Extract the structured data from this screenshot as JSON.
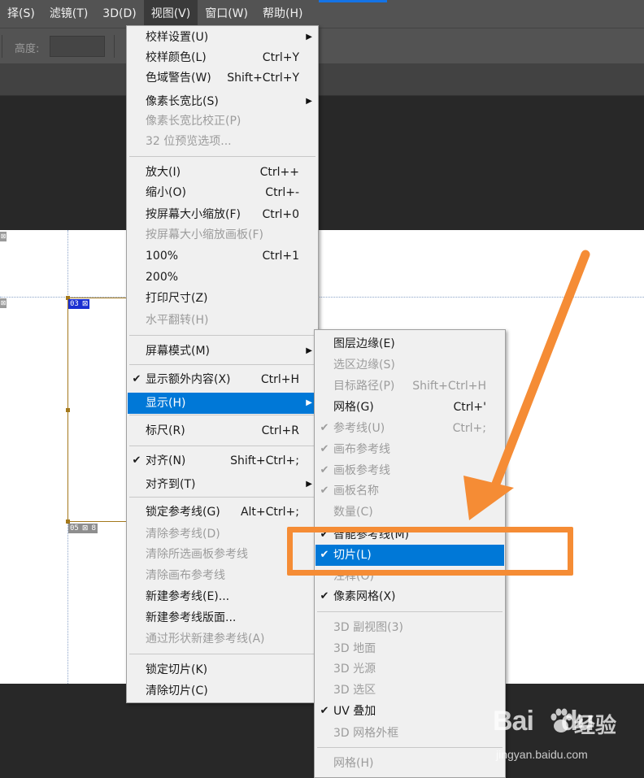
{
  "menubar": {
    "items": [
      "择(S)",
      "滤镜(T)",
      "3D(D)",
      "视图(V)",
      "窗口(W)",
      "帮助(H)"
    ]
  },
  "options_bar": {
    "height_label": "高度:"
  },
  "canvas": {
    "slice_top_label": "03",
    "slice_bottom_label": "05"
  },
  "view_menu": {
    "items": [
      {
        "label": "校样设置(U)",
        "shortcut": "",
        "submenu": true,
        "enabled": true,
        "checked": false
      },
      {
        "label": "校样颜色(L)",
        "shortcut": "Ctrl+Y",
        "enabled": true,
        "checked": false
      },
      {
        "label": "色域警告(W)",
        "shortcut": "Shift+Ctrl+Y",
        "enabled": true,
        "checked": false
      },
      {
        "label": "像素长宽比(S)",
        "shortcut": "",
        "submenu": true,
        "enabled": true,
        "checked": false
      },
      {
        "label": "像素长宽比校正(P)",
        "shortcut": "",
        "enabled": false,
        "checked": false
      },
      {
        "label": "32 位预览选项...",
        "shortcut": "",
        "enabled": false,
        "checked": false
      },
      {
        "label": "放大(I)",
        "shortcut": "Ctrl++",
        "enabled": true,
        "checked": false
      },
      {
        "label": "缩小(O)",
        "shortcut": "Ctrl+-",
        "enabled": true,
        "checked": false
      },
      {
        "label": "按屏幕大小缩放(F)",
        "shortcut": "Ctrl+0",
        "enabled": true,
        "checked": false
      },
      {
        "label": "按屏幕大小缩放画板(F)",
        "shortcut": "",
        "enabled": false,
        "checked": false
      },
      {
        "label": "100%",
        "shortcut": "Ctrl+1",
        "enabled": true,
        "checked": false
      },
      {
        "label": "200%",
        "shortcut": "",
        "enabled": true,
        "checked": false
      },
      {
        "label": "打印尺寸(Z)",
        "shortcut": "",
        "enabled": true,
        "checked": false
      },
      {
        "label": "水平翻转(H)",
        "shortcut": "",
        "enabled": false,
        "checked": false
      },
      {
        "label": "屏幕模式(M)",
        "shortcut": "",
        "submenu": true,
        "enabled": true,
        "checked": false
      },
      {
        "label": "显示额外内容(X)",
        "shortcut": "Ctrl+H",
        "enabled": true,
        "checked": true
      },
      {
        "label": "显示(H)",
        "shortcut": "",
        "submenu": true,
        "enabled": true,
        "checked": false,
        "highlight": true
      },
      {
        "label": "标尺(R)",
        "shortcut": "Ctrl+R",
        "enabled": true,
        "checked": false
      },
      {
        "label": "对齐(N)",
        "shortcut": "Shift+Ctrl+;",
        "enabled": true,
        "checked": true
      },
      {
        "label": "对齐到(T)",
        "shortcut": "",
        "submenu": true,
        "enabled": true,
        "checked": false
      },
      {
        "label": "锁定参考线(G)",
        "shortcut": "Alt+Ctrl+;",
        "enabled": true,
        "checked": false
      },
      {
        "label": "清除参考线(D)",
        "shortcut": "",
        "enabled": false,
        "checked": false
      },
      {
        "label": "清除所选画板参考线",
        "shortcut": "",
        "enabled": false,
        "checked": false
      },
      {
        "label": "清除画布参考线",
        "shortcut": "",
        "enabled": false,
        "checked": false
      },
      {
        "label": "新建参考线(E)...",
        "shortcut": "",
        "enabled": true,
        "checked": false
      },
      {
        "label": "新建参考线版面...",
        "shortcut": "",
        "enabled": true,
        "checked": false
      },
      {
        "label": "通过形状新建参考线(A)",
        "shortcut": "",
        "enabled": false,
        "checked": false
      },
      {
        "label": "锁定切片(K)",
        "shortcut": "",
        "enabled": true,
        "checked": false
      },
      {
        "label": "清除切片(C)",
        "shortcut": "",
        "enabled": true,
        "checked": false
      }
    ],
    "check_glyph": "✔",
    "arrow_glyph": "▶"
  },
  "show_menu": {
    "items": [
      {
        "label": "图层边缘(E)",
        "shortcut": "",
        "enabled": true,
        "checked": false
      },
      {
        "label": "选区边缘(S)",
        "shortcut": "",
        "enabled": false,
        "checked": false
      },
      {
        "label": "目标路径(P)",
        "shortcut": "Shift+Ctrl+H",
        "enabled": false,
        "checked": false
      },
      {
        "label": "网格(G)",
        "shortcut": "Ctrl+'",
        "enabled": true,
        "checked": false
      },
      {
        "label": "参考线(U)",
        "shortcut": "Ctrl+;",
        "enabled": false,
        "checked": true
      },
      {
        "label": "画布参考线",
        "shortcut": "",
        "enabled": false,
        "checked": true
      },
      {
        "label": "画板参考线",
        "shortcut": "",
        "enabled": false,
        "checked": true
      },
      {
        "label": "画板名称",
        "shortcut": "",
        "enabled": false,
        "checked": true
      },
      {
        "label": "数量(C)",
        "shortcut": "",
        "enabled": false,
        "checked": false
      },
      {
        "label": "智能参考线(M)",
        "shortcut": "",
        "enabled": true,
        "checked": true
      },
      {
        "label": "切片(L)",
        "shortcut": "",
        "enabled": true,
        "checked": true,
        "highlight": true
      },
      {
        "label": "注释(O)",
        "shortcut": "",
        "enabled": false,
        "checked": false
      },
      {
        "label": "像素网格(X)",
        "shortcut": "",
        "enabled": true,
        "checked": true
      },
      {
        "label": "3D 副视图(3)",
        "shortcut": "",
        "enabled": false,
        "checked": false
      },
      {
        "label": "3D 地面",
        "shortcut": "",
        "enabled": false,
        "checked": false
      },
      {
        "label": "3D 光源",
        "shortcut": "",
        "enabled": false,
        "checked": false
      },
      {
        "label": "3D 选区",
        "shortcut": "",
        "enabled": false,
        "checked": false
      },
      {
        "label": "UV 叠加",
        "shortcut": "",
        "enabled": true,
        "checked": true
      },
      {
        "label": "3D 网格外框",
        "shortcut": "",
        "enabled": false,
        "checked": false
      },
      {
        "label": "网格(H)",
        "shortcut": "",
        "enabled": false,
        "checked": false
      }
    ]
  },
  "watermark": {
    "brand": "Bai",
    "brand2": "du",
    "cn": "经验",
    "url": "jingyan.baidu.com"
  },
  "colors": {
    "highlight": "#0078d7",
    "annotation": "#f58c35",
    "slice_border": "#a4791c"
  }
}
